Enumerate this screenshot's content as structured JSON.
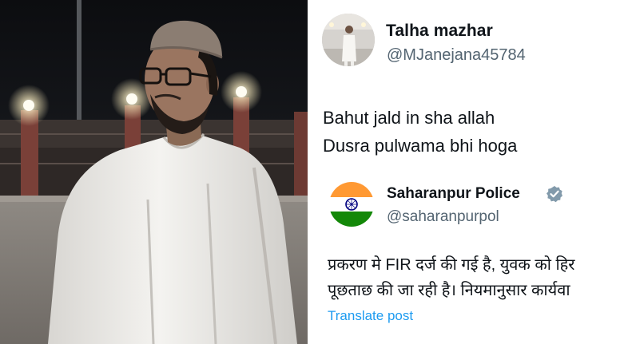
{
  "tweet": {
    "author_name": "Talha mazhar",
    "author_handle": "@MJanejana45784",
    "text_lines": [
      "Bahut jald in sha allah",
      "Dusra pulwama bhi hoga"
    ]
  },
  "reply": {
    "author_name": "Saharanpur Police",
    "author_handle": "@saharanpurpol",
    "verified_icon": "verified-badge-icon",
    "text_lines": [
      "प्रकरण मे FIR दर्ज की गई है, युवक को हिर",
      "पूछताछ की जा रही है। नियमानुसार कार्यवा"
    ],
    "translate_label": "Translate post"
  },
  "colors": {
    "text_primary": "#0f1419",
    "text_secondary": "#536471",
    "link_blue": "#1d9bf0",
    "flag_saffron": "#ff9933",
    "flag_green": "#138808",
    "chakra_blue": "#000080"
  }
}
